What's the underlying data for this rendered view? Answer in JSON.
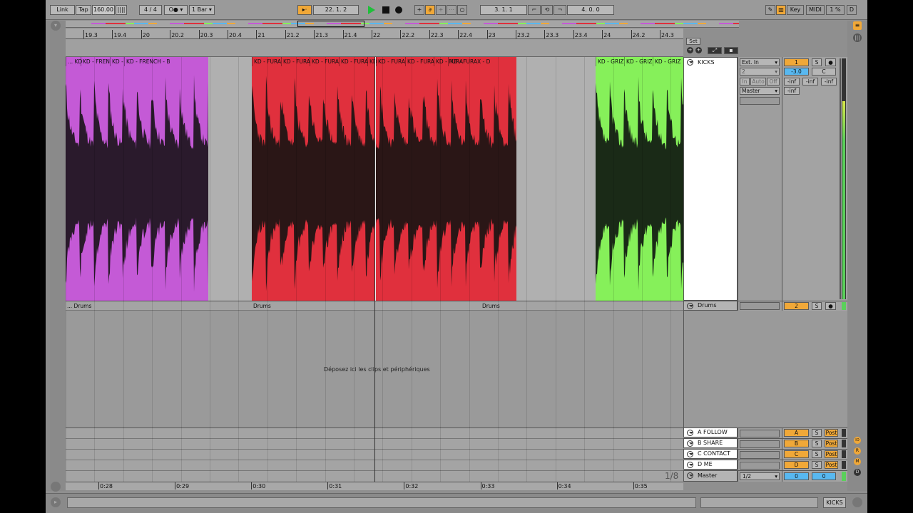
{
  "transport": {
    "link": "Link",
    "tap": "Tap",
    "tempo": "160.00",
    "signature_num": "4",
    "signature_den": "4",
    "metronome": "O●",
    "quantize": "1 Bar",
    "arrangement_position": "22.   1.   2",
    "loop_start": "3.   1.   1",
    "loop_length": "4.   0.   0",
    "key": "Key",
    "midi": "MIDI",
    "cpu": "1 %",
    "disk": "D"
  },
  "ruler": {
    "bars": [
      "19.3",
      "19.4",
      "20",
      "20.2",
      "20.3",
      "20.4",
      "21",
      "21.2",
      "21.3",
      "21.4",
      "22",
      "22.2",
      "22.3",
      "22.4",
      "23",
      "23.2",
      "23.3",
      "23.4",
      "24",
      "24.2",
      "24.3"
    ],
    "times": [
      "0:28",
      "0:29",
      "0:30",
      "0:31",
      "0:32",
      "0:33",
      "0:34",
      "0:35"
    ]
  },
  "set_label": "Set",
  "tracks": {
    "kicks": {
      "name": "KICKS",
      "clips_purple": [
        "... KD",
        "KD - FREN",
        "KD -",
        "KD - FRENCH - B"
      ],
      "clips_red": [
        "KD - FURA",
        "KD - FURA",
        "KD - FURA",
        "KD - FURA",
        "KD",
        "KD - FURA",
        "KD - FURA",
        "KD - FURA",
        "KD - FURAX - D"
      ],
      "clips_green": [
        "KD - GRIZ",
        "KD - GRIZ",
        "KD - GRIZ"
      ],
      "input_type": "Ext. In",
      "input_channel": "2",
      "monitor_in": "In",
      "monitor_auto": "Auto",
      "monitor_off": "Off",
      "output": "Master",
      "track_number": "1",
      "solo": "S",
      "volume": "-3.0",
      "pan": "C",
      "meter_a": "-inf",
      "meter_b": "-inf",
      "meter_c": "-inf",
      "meter_d": "-inf"
    },
    "drums": {
      "name": "Drums",
      "clip_labels": [
        "... Drums",
        "Drums",
        "Drums"
      ],
      "track_number": "2",
      "solo": "S"
    }
  },
  "drop_hint": "Déposez ici les clips et périphériques",
  "returns": [
    {
      "name": "A FOLLOW",
      "letter": "A",
      "solo": "S",
      "post": "Post"
    },
    {
      "name": "B SHARE",
      "letter": "B",
      "solo": "S",
      "post": "Post"
    },
    {
      "name": "C CONTACT",
      "letter": "C",
      "solo": "S",
      "post": "Post"
    },
    {
      "name": "D ME",
      "letter": "D",
      "solo": "S",
      "post": "Post"
    }
  ],
  "master": {
    "name": "Master",
    "zoom": "1/8",
    "cue": "1/2",
    "vol_a": "0",
    "vol_b": "0"
  },
  "side_buttons": [
    "IO",
    "R",
    "M",
    "D"
  ],
  "status": {
    "selected_track": "KICKS"
  },
  "colors": {
    "purple": "#c45ad6",
    "red": "#e0303d",
    "green": "#86f05a",
    "accent": "#f0a838",
    "blue": "#58b8f0"
  }
}
